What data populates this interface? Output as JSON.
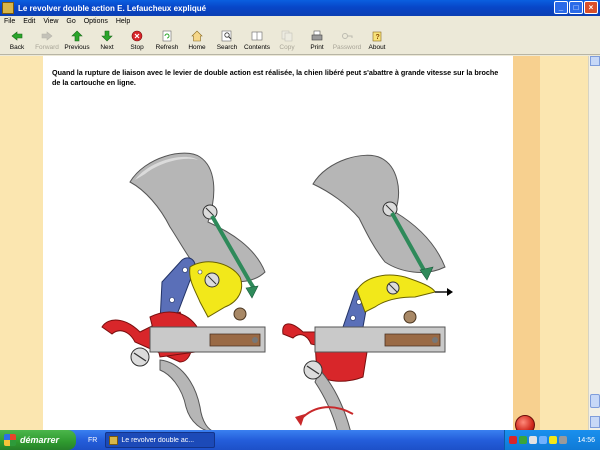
{
  "window": {
    "title": "Le revolver double action E. Lefaucheux expliqué",
    "buttons": [
      "_",
      "□",
      "×"
    ]
  },
  "menu": [
    "File",
    "Edit",
    "View",
    "Go",
    "Options",
    "Help"
  ],
  "toolbar": [
    {
      "label": "Back",
      "icon": "arrow-left-icon",
      "enabled": true
    },
    {
      "label": "Forward",
      "icon": "arrow-right-icon",
      "enabled": false
    },
    {
      "label": "Previous",
      "icon": "arrow-up-icon",
      "enabled": true
    },
    {
      "label": "Next",
      "icon": "arrow-down-icon",
      "enabled": true
    },
    {
      "label": "Stop",
      "icon": "stop-icon",
      "enabled": true
    },
    {
      "label": "Refresh",
      "icon": "refresh-icon",
      "enabled": true
    },
    {
      "label": "Home",
      "icon": "home-icon",
      "enabled": true
    },
    {
      "label": "Search",
      "icon": "search-icon",
      "enabled": true
    },
    {
      "label": "Contents",
      "icon": "contents-icon",
      "enabled": true
    },
    {
      "label": "Copy",
      "icon": "copy-icon",
      "enabled": false
    },
    {
      "label": "Print",
      "icon": "print-icon",
      "enabled": true
    },
    {
      "label": "Password",
      "icon": "key-icon",
      "enabled": false
    },
    {
      "label": "About",
      "icon": "about-icon",
      "enabled": true
    }
  ],
  "content": {
    "caption": "Quand la rupture de liaison avec le levier de double action est réalisée, la chien libéré peut s'abattre à grande vitesse sur la broche de la cartouche en ligne."
  },
  "taskbar": {
    "start_label": "démarrer",
    "language": "FR",
    "task_label": "Le revolver double ac...",
    "clock": "14:56"
  },
  "colors": {
    "title_blue": "#0846c8",
    "page_band": "#f7d08f",
    "hammer_gray": "#b8b8b8",
    "trigger_red": "#d8262a",
    "lever_yellow": "#f2e81a",
    "link_blue": "#5a6fb8",
    "spring_green": "#2e8a5a"
  }
}
